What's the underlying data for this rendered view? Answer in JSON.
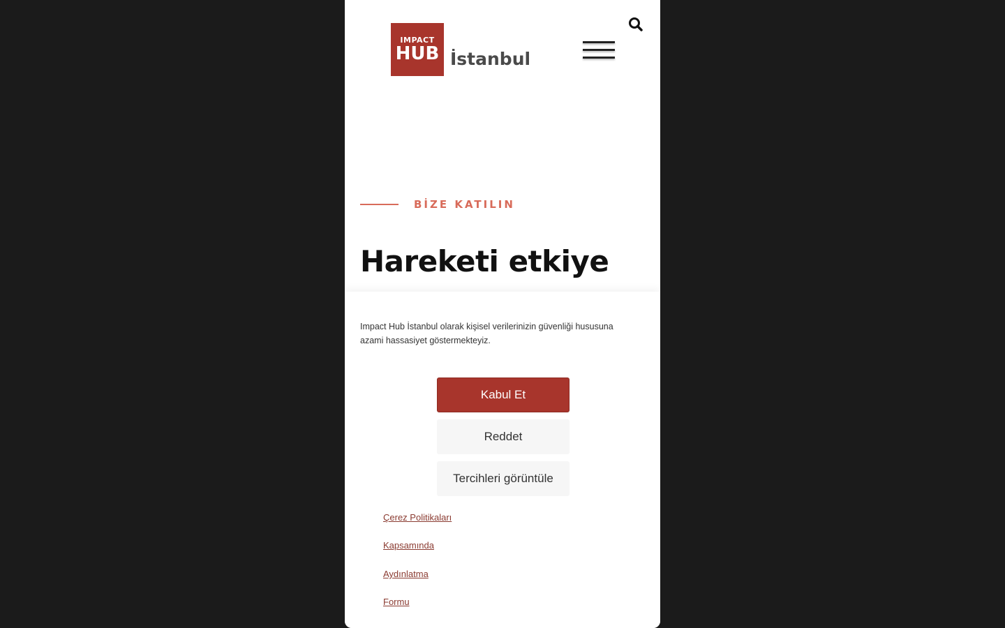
{
  "header": {
    "logo": {
      "line1": "IMPACT",
      "line2": "HUB",
      "city": "İstanbul",
      "brand_color": "#a8352c"
    }
  },
  "hero": {
    "eyebrow": "BİZE KATILIN",
    "headline": "Hareketi etkiye"
  },
  "consent": {
    "message": "Impact Hub İstanbul olarak kişisel verilerinizin güvenliği hususuna azami hassasiyet göstermekteyiz.",
    "accept_label": "Kabul Et",
    "reject_label": "Reddet",
    "preferences_label": "Tercihleri görüntüle",
    "links": [
      "Çerez Politikaları",
      "Kapsamında",
      "Aydınlatma",
      "Formu"
    ]
  },
  "colors": {
    "accent": "#a8352c",
    "eyebrow": "#d86b5a",
    "background": "#1b1b1b"
  },
  "icons": {
    "search": "search-icon",
    "menu": "hamburger-menu-icon"
  }
}
